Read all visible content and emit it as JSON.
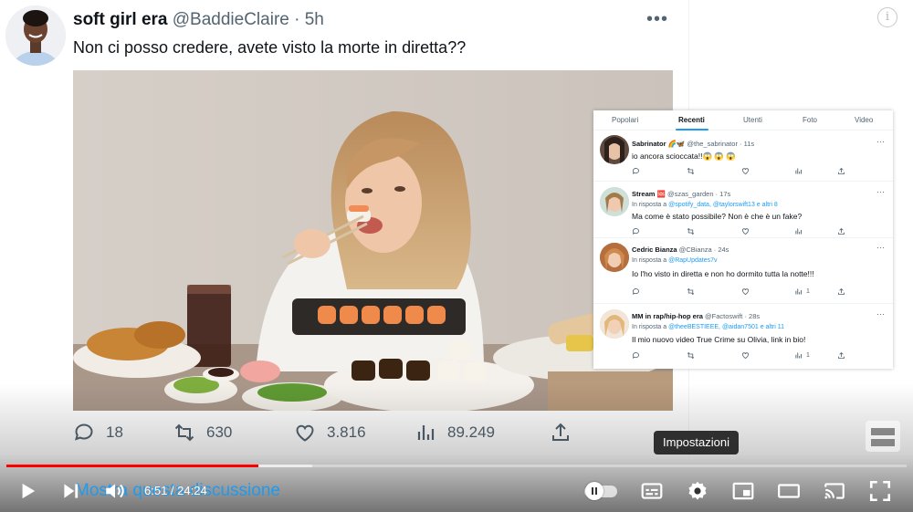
{
  "tweet": {
    "display_name": "soft girl era",
    "handle": "@BaddieClaire",
    "separator": "·",
    "time": "5h",
    "text": "Non ci posso credere, avete visto la morte in diretta??",
    "more_icon": "more-horizontal-icon",
    "stats": {
      "replies": "18",
      "retweets": "630",
      "likes": "3.816",
      "views": "89.249"
    },
    "show_thread": "Mostra questa discussione"
  },
  "replies_panel": {
    "tabs": [
      "Popolari",
      "Recenti",
      "Utenti",
      "Foto",
      "Video"
    ],
    "active_tab": "Recenti",
    "replies": [
      {
        "name": "Sabrinator 🌈🦋",
        "meta": "@the_sabrinator · 11s",
        "reply_to_prefix": "",
        "mentions": "",
        "text": "io ancora scioccata!!😱 😱 😱",
        "likes": "",
        "views": ""
      },
      {
        "name": "Stream 🆘",
        "meta": "@szas_garden · 17s",
        "reply_to_prefix": "In risposta a",
        "mentions": "@spotify_data, @taylorswift13 e altri 8",
        "text": "Ma come è stato possibile? Non è che è un fake?",
        "likes": "",
        "views": ""
      },
      {
        "name": "Cedric Bianza",
        "meta": "@CBianza · 24s",
        "reply_to_prefix": "In risposta a",
        "mentions": "@RapUpdates7v",
        "text": "Io l'ho visto in diretta e non ho dormito tutta la notte!!!",
        "likes": "",
        "views": "1"
      },
      {
        "name": "MM in rap/hip-hop era",
        "meta": "@Factoswift · 28s",
        "reply_to_prefix": "In risposta a",
        "mentions": "@theeBESTIEEE, @aidan7501 e altri 11",
        "text": "Il mio nuovo video True Crime su Olivia, link in bio!",
        "likes": "",
        "views": "1"
      }
    ]
  },
  "player": {
    "time_current": "6:51",
    "time_separator": " / ",
    "time_total": "24:24",
    "played_fraction": 0.28,
    "loaded_fraction": 0.34,
    "tooltip": "Impostazioni",
    "progress_color": "#ff0000",
    "controls": [
      "play-icon",
      "next-icon",
      "volume-icon",
      "autoplay-toggle",
      "subtitles-icon",
      "settings-icon",
      "miniplayer-icon",
      "theater-icon",
      "cast-icon",
      "fullscreen-icon"
    ]
  },
  "colors": {
    "accent": "#1d9bf0",
    "text_secondary": "#536471",
    "text_primary": "#0f1419"
  }
}
